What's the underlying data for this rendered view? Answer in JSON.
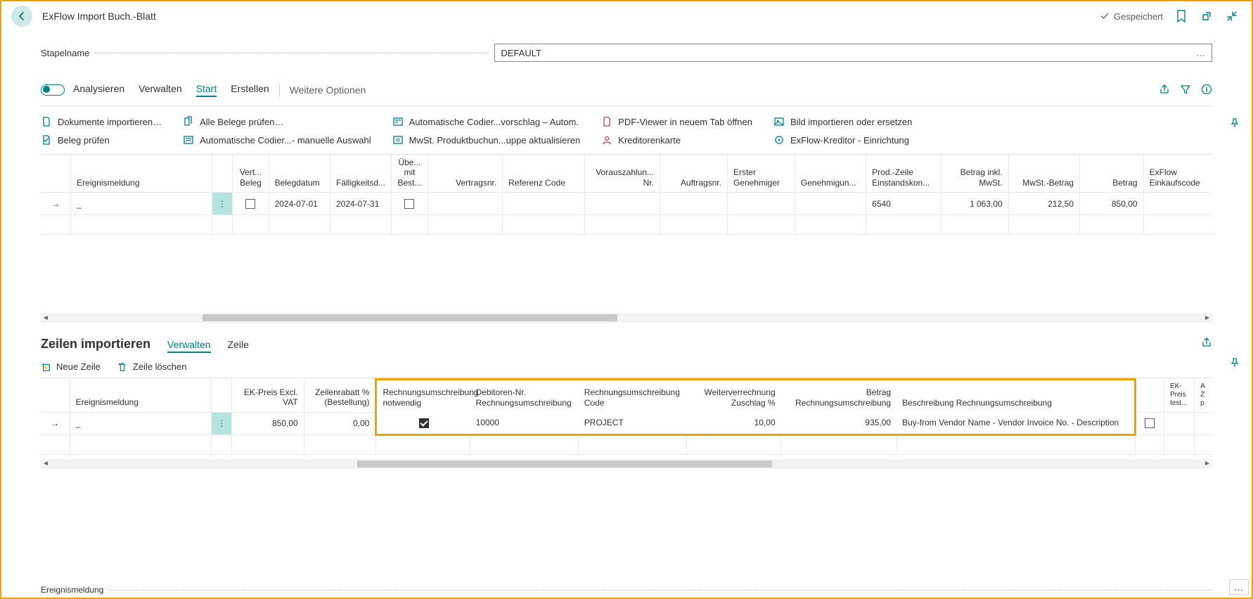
{
  "header": {
    "title": "ExFlow Import Buch.-Blatt",
    "saved_label": "Gespeichert"
  },
  "stapel": {
    "label": "Stapelname",
    "value": "DEFAULT",
    "more": "…"
  },
  "tabs": {
    "analysieren": "Analysieren",
    "verwalten": "Verwalten",
    "start": "Start",
    "erstellen": "Erstellen",
    "weitere": "Weitere Optionen"
  },
  "actions": {
    "dokumente": "Dokumente importieren…",
    "beleg_pruefen": "Beleg prüfen",
    "alle_belege": "Alle Belege prüfen…",
    "auto_manuell": "Automatische Codier...- manuelle Auswahl",
    "auto_vorschlag": "Automatische Codier...vorschlag – Autom.",
    "mwst": "MwSt. Produktbuchun...uppe aktualisieren",
    "pdf": "PDF-Viewer in neuem Tab öffnen",
    "kreditorenkarte": "Kreditorenkarte",
    "bild": "Bild importieren oder ersetzen",
    "exflow_kreditor": "ExFlow-Kreditor - Einrichtung"
  },
  "grid1": {
    "headers": {
      "ereignis": "Ereignismeldung",
      "vert_beleg": "Vert... Beleg",
      "belegdatum": "Belegdatum",
      "faelligkeit": "Fälligkeitsd...",
      "uebe": "Übe... mit Best...",
      "vertragsnr": "Vertragsnr.",
      "referenz": "Referenz Code",
      "voraus": "Vorauszahlun... Nr.",
      "auftrag": "Auftragsnr.",
      "erster": "Erster Genehmiger",
      "genehmigun": "Genehmigun...",
      "prod": "Prod.-Zeile Einstandskon...",
      "betrag_inkl": "Betrag inkl. MwSt.",
      "mwst_betrag": "MwSt.-Betrag",
      "betrag": "Betrag",
      "exflow": "ExFlow Einkaufscode"
    },
    "row": {
      "ereignis": "_",
      "belegdatum": "2024-07-01",
      "faelligkeit": "2024-07-31",
      "prod": "6540",
      "betrag_inkl": "1 063,00",
      "mwst_betrag": "212,50",
      "betrag": "850,00"
    }
  },
  "section2": {
    "title": "Zeilen importieren",
    "verwalten": "Verwalten",
    "zeile": "Zeile",
    "neue_zeile": "Neue Zeile",
    "zeile_loeschen": "Zeile löschen"
  },
  "grid2": {
    "headers": {
      "ereignis": "Ereignismeldung",
      "ek_preis": "EK-Preis Excl. VAT",
      "zeilenrabatt": "Zeilenrabatt % (Bestellung)",
      "rech_notwendig": "Rechnungsumschreibung notwendig",
      "debitor": "Debitoren-Nr. Rechnungsumschreibung",
      "rech_code": "Rechnungsumschreibung Code",
      "weiter": "Weiterverrechnung Zuschlag %",
      "betrag_rech": "Betrag Rechnungsumschreibung",
      "beschreibung": "Beschreibung Rechnungsumschreibung",
      "ek_preis2": "EK-Preis test...",
      "az": "A Z p"
    },
    "row": {
      "ereignis": "_",
      "ek_preis": "850,00",
      "zeilenrabatt": "0,00",
      "debitor": "10000",
      "rech_code": "PROJECT",
      "weiter": "10,00",
      "betrag_rech": "935,00",
      "beschreibung": "Buy-from Vendor Name - Vendor Invoice No. - Description"
    }
  },
  "status": {
    "label": "Ereignismeldung",
    "more": "…"
  }
}
